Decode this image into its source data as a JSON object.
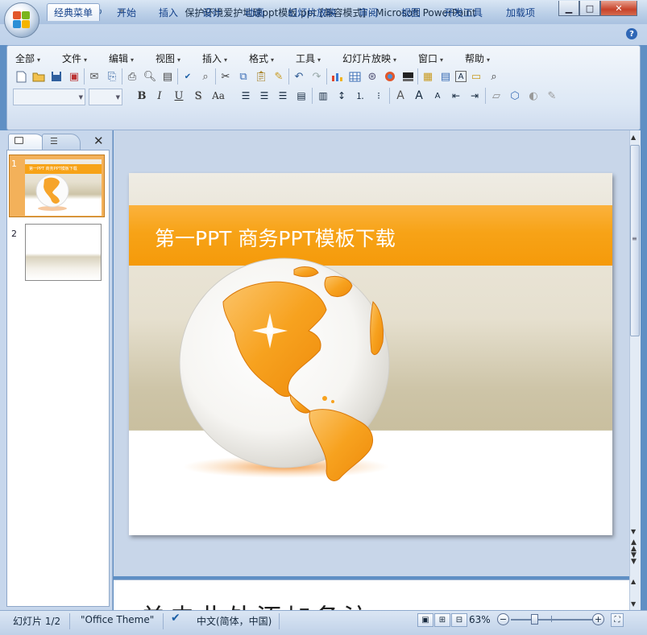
{
  "window": {
    "title": "保护环境爱护地球ppt模板.ppt [兼容模式] - Microsoft PowerPoint",
    "minimize_icon": "minimize-icon",
    "maximize_icon": "maximize-icon",
    "close_icon": "close-icon"
  },
  "ribbon_tabs": [
    {
      "label": "经典菜单",
      "active": true
    },
    {
      "label": "开始"
    },
    {
      "label": "插入"
    },
    {
      "label": "设计"
    },
    {
      "label": "动画"
    },
    {
      "label": "幻灯片放映"
    },
    {
      "label": "审阅"
    },
    {
      "label": "视图"
    },
    {
      "label": "开发工具"
    },
    {
      "label": "加载项"
    }
  ],
  "classic_menu": [
    "全部",
    "文件",
    "编辑",
    "视图",
    "插入",
    "格式",
    "工具",
    "幻灯片放映",
    "窗口",
    "帮助"
  ],
  "toolbar_format": {
    "bold": "B",
    "italic": "I",
    "underline": "U",
    "shadow": "S",
    "change_case": "Aa"
  },
  "slides_pane": {
    "thumbnails": [
      {
        "number": "1",
        "caption": "第一PPT 商务PPT模板下载",
        "selected": true
      },
      {
        "number": "2"
      }
    ]
  },
  "slide": {
    "title": "第一PPT  商务PPT模板下载",
    "colors": {
      "band": "#f7a317",
      "title_text": "#ffffff"
    }
  },
  "notes": {
    "text": "单击此处添加备注"
  },
  "status": {
    "slide_counter": "幻灯片 1/2",
    "theme": "\"Office Theme\"",
    "language": "中文(简体，中国)",
    "zoom": "63%",
    "zoom_level": 0.63
  }
}
